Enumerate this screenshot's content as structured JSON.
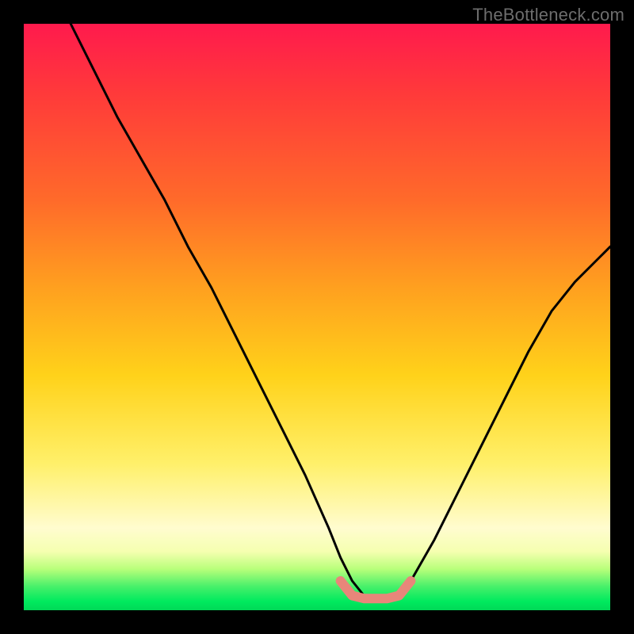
{
  "watermark": "TheBottleneck.com",
  "chart_data": {
    "type": "line",
    "title": "",
    "xlabel": "",
    "ylabel": "",
    "xlim": [
      0,
      100
    ],
    "ylim": [
      0,
      100
    ],
    "series": [
      {
        "name": "bottleneck-curve",
        "x": [
          8,
          12,
          16,
          20,
          24,
          28,
          32,
          36,
          40,
          44,
          48,
          52,
          54,
          56,
          58,
          60,
          62,
          64,
          66,
          70,
          74,
          78,
          82,
          86,
          90,
          94,
          98,
          100
        ],
        "values": [
          100,
          92,
          84,
          77,
          70,
          62,
          55,
          47,
          39,
          31,
          23,
          14,
          9,
          5,
          2.5,
          2,
          2,
          2.5,
          5,
          12,
          20,
          28,
          36,
          44,
          51,
          56,
          60,
          62
        ]
      },
      {
        "name": "highlight-flat-region",
        "x": [
          54,
          56,
          58,
          60,
          62,
          64,
          66
        ],
        "values": [
          5,
          2.5,
          2,
          2,
          2,
          2.5,
          5
        ]
      }
    ],
    "colors": {
      "curve": "#000000",
      "highlight": "#e8867a",
      "gradient_top": "#ff1a4d",
      "gradient_mid": "#ffd21a",
      "gradient_bottom": "#00d957"
    },
    "annotations": []
  }
}
